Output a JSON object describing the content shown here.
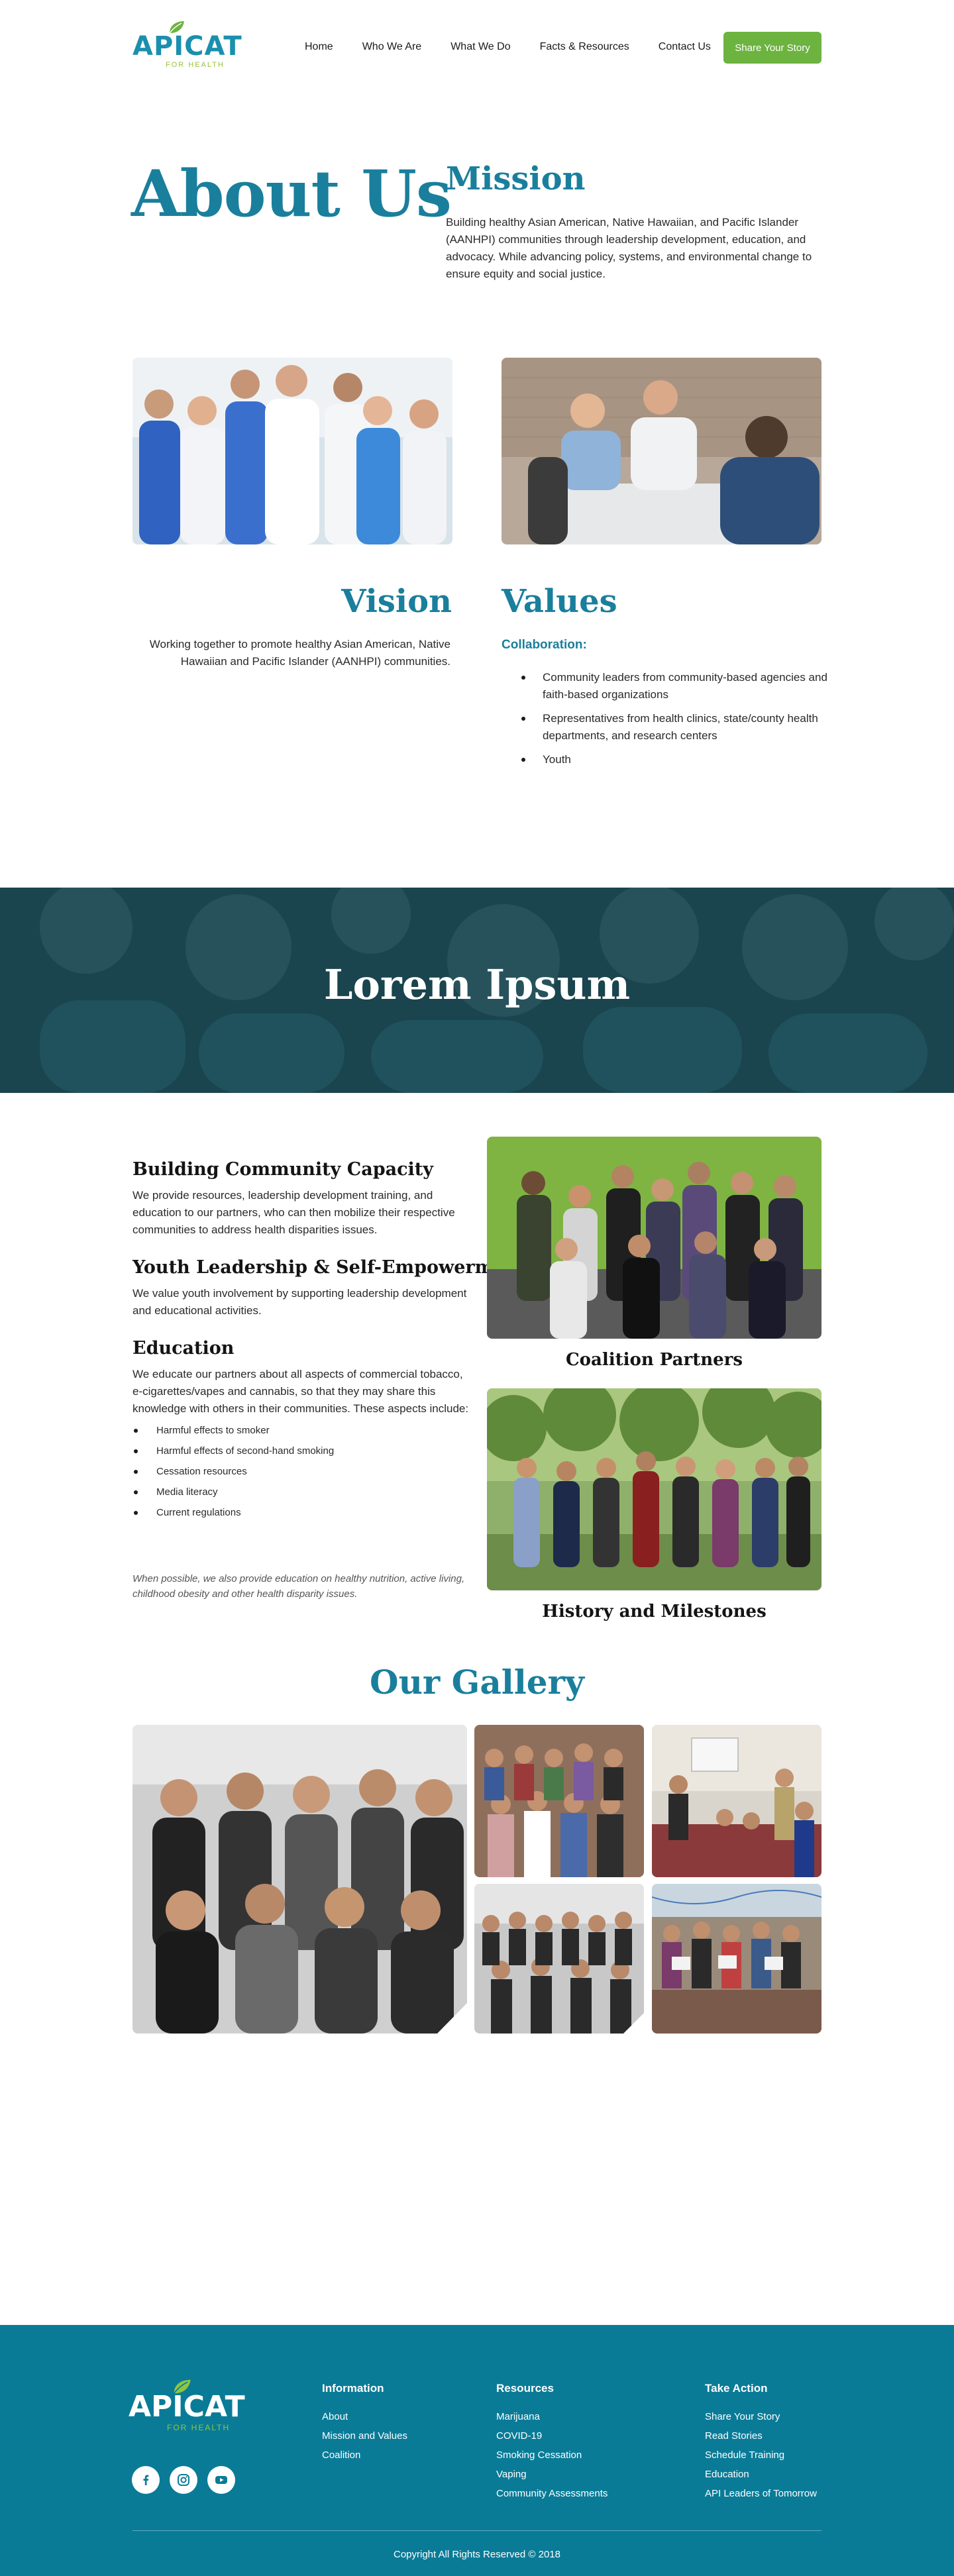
{
  "header": {
    "logo_text": "APICAT",
    "logo_sub": "FOR HEALTH",
    "nav": [
      "Home",
      "Who We Are",
      "What We Do",
      "Facts & Resources",
      "Contact Us"
    ],
    "cta": "Share Your Story"
  },
  "about": {
    "title": "About Us",
    "mission_title": "Mission",
    "mission_text": "Building healthy Asian American, Native Hawaiian, and Pacific Islander (AANHPI) communities through leadership development, education, and advocacy. While advancing policy, systems, and environmental change to ensure equity and social justice."
  },
  "vision": {
    "title": "Vision",
    "text": "Working together to promote healthy Asian American, Native Hawaiian and Pacific Islander (AANHPI) communities."
  },
  "values": {
    "title": "Values",
    "subtitle": "Collaboration:",
    "items": [
      "Community leaders from community-based agencies and faith-based organizations",
      "Representatives from health clinics, state/county health departments, and research centers",
      "Youth"
    ]
  },
  "banner": {
    "title": "Lorem Ipsum"
  },
  "programs": {
    "h1": "Building Community Capacity",
    "p1": "We provide resources, leadership development training, and education to our partners, who can then mobilize their respective communities to address health disparities issues.",
    "h2": "Youth Leadership & Self-Empowerment",
    "p2": "We value youth involvement by supporting leadership development and educational activities.",
    "h3": "Education",
    "p3": "We educate our partners about all aspects of commercial tobacco, e-cigarettes/vapes and cannabis, so that they may share this knowledge with others in their communities. These aspects include:",
    "list": [
      "Harmful effects to smoker",
      "Harmful effects of second-hand smoking",
      "Cessation resources",
      "Media literacy",
      "Current regulations"
    ],
    "note": "When possible, we also provide education on healthy nutrition, active living, childhood obesity and other health disparity issues.",
    "card1": "Coalition Partners",
    "card2": "History and Milestones"
  },
  "gallery": {
    "title": "Our Gallery"
  },
  "footer": {
    "logo_text": "APICAT",
    "logo_sub": "FOR HEALTH",
    "cols": [
      {
        "title": "Information",
        "links": [
          "About",
          "Mission and Values",
          "Coalition"
        ]
      },
      {
        "title": "Resources",
        "links": [
          "Marijuana",
          "COVID-19",
          "Smoking Cessation",
          "Vaping",
          "Community Assessments"
        ]
      },
      {
        "title": "Take Action",
        "links": [
          "Share Your Story",
          "Read Stories",
          "Schedule Training",
          "Education",
          "API Leaders of Tomorrow"
        ]
      }
    ],
    "social": [
      "facebook-icon",
      "instagram-icon",
      "youtube-icon"
    ],
    "copyright": "Copyright All Rights Reserved © 2018"
  },
  "colors": {
    "brand": "#1a7f9c",
    "accent": "#6cb33f",
    "footer": "#0a7b97"
  }
}
